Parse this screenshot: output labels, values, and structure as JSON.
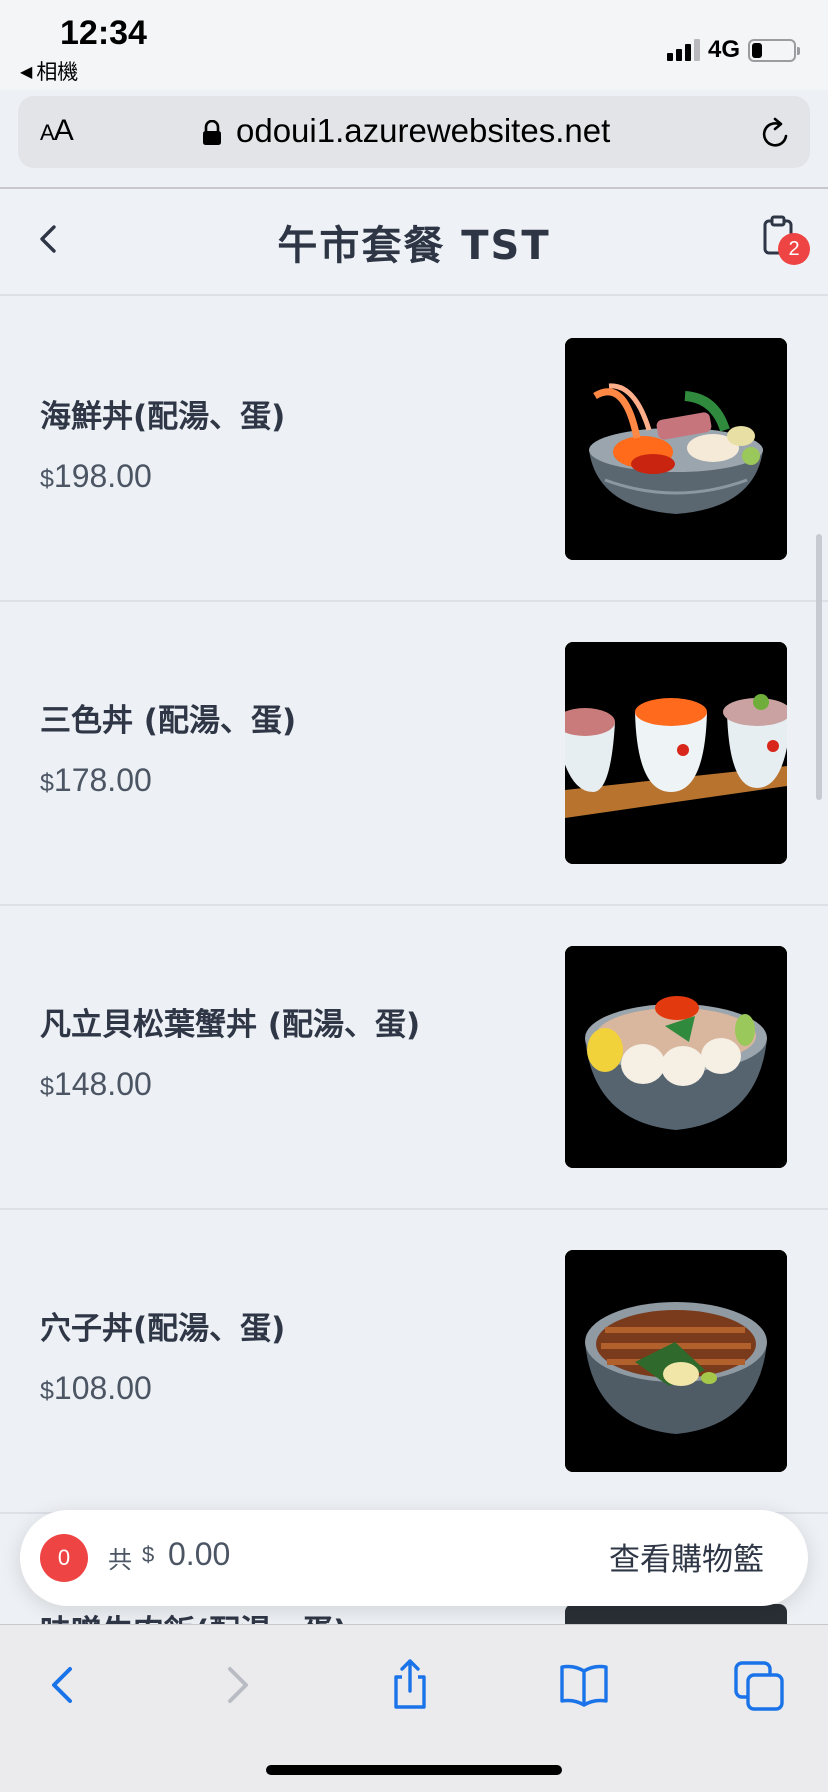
{
  "status_bar": {
    "time": "12:34",
    "back_app": "相機",
    "network": "4G",
    "battery_level": 0.25
  },
  "browser": {
    "aa_label_small": "A",
    "aa_label_large": "A",
    "url": "odoui1.azurewebsites.net"
  },
  "header": {
    "title": "午市套餐 TST",
    "cart_badge": "2"
  },
  "menu": {
    "items": [
      {
        "name": "海鮮丼(配湯、蛋)",
        "currency": "$",
        "price": "198.00",
        "image_icon": "seafood-bowl"
      },
      {
        "name": "三色丼 (配湯、蛋)",
        "currency": "$",
        "price": "178.00",
        "image_icon": "three-color-bowls"
      },
      {
        "name": "凡立貝松葉蟹丼 (配湯、蛋)",
        "currency": "$",
        "price": "148.00",
        "image_icon": "scallop-crab-bowl"
      },
      {
        "name": "穴子丼(配湯、蛋)",
        "currency": "$",
        "price": "108.00",
        "image_icon": "eel-bowl"
      }
    ],
    "partial_item_name": "味噌牛肉飯(配湯、蛋)"
  },
  "cart_bar": {
    "count": "0",
    "total_label": "共",
    "currency": "$",
    "total": "0.00",
    "view_cart_label": "查看購物籃"
  },
  "colors": {
    "accent_red": "#ef4444",
    "page_bg": "#edf0f4",
    "text_dark": "#2f3747"
  }
}
